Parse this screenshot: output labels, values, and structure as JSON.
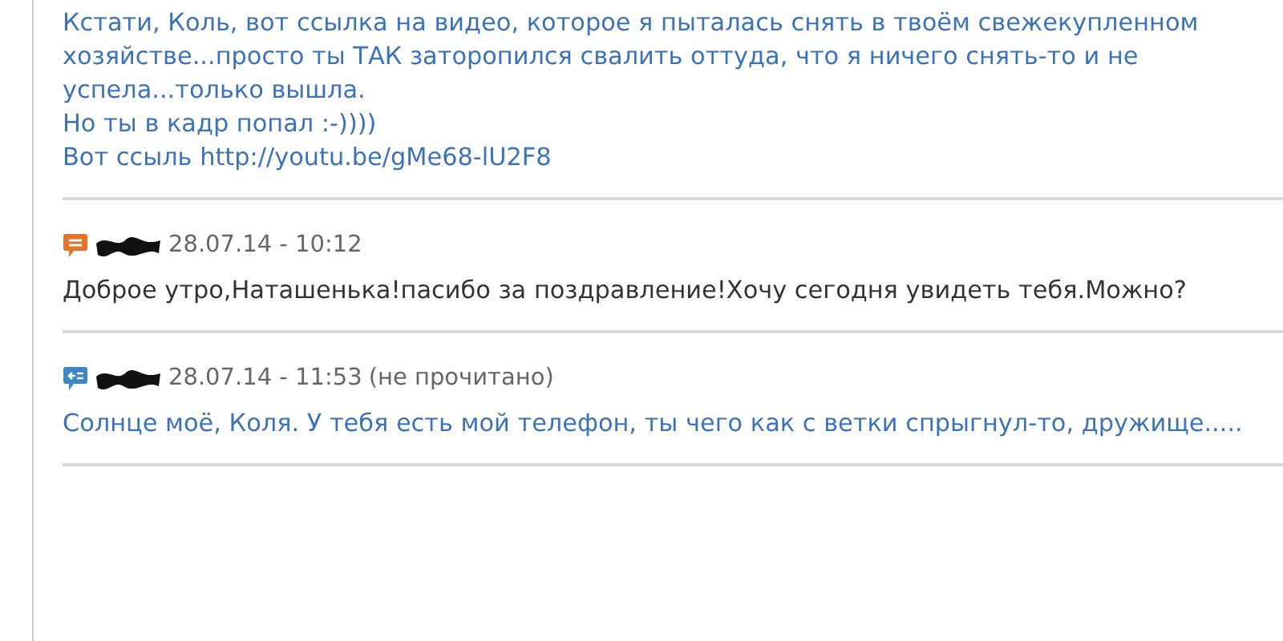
{
  "messages": [
    {
      "kind": "outgoing",
      "text": "Кстати, Коль, вот ссылка на видео, которое я пыталась снять в твоём свежекупленном хозяйстве...просто ты ТАК заторопился свалить оттуда, что я ничего снять-то и не успела...только вышла.\nНо ты в кадр попал :-))))\nВот ссыль http://youtu.be/gMe68-lU2F8"
    },
    {
      "kind": "incoming",
      "date": "28.07.14 - 10:12",
      "text": "Доброе утро,Наташенька!пасибо за поздравление!Хочу сегодня увидеть тебя.Можно?"
    },
    {
      "kind": "outgoing",
      "date": "28.07.14 - 11:53",
      "status": "(не прочитано)",
      "text": "Солнце моё, Коля. У тебя есть мой телефон, ты чего как с ветки спрыгнул-то, дружище....."
    }
  ]
}
